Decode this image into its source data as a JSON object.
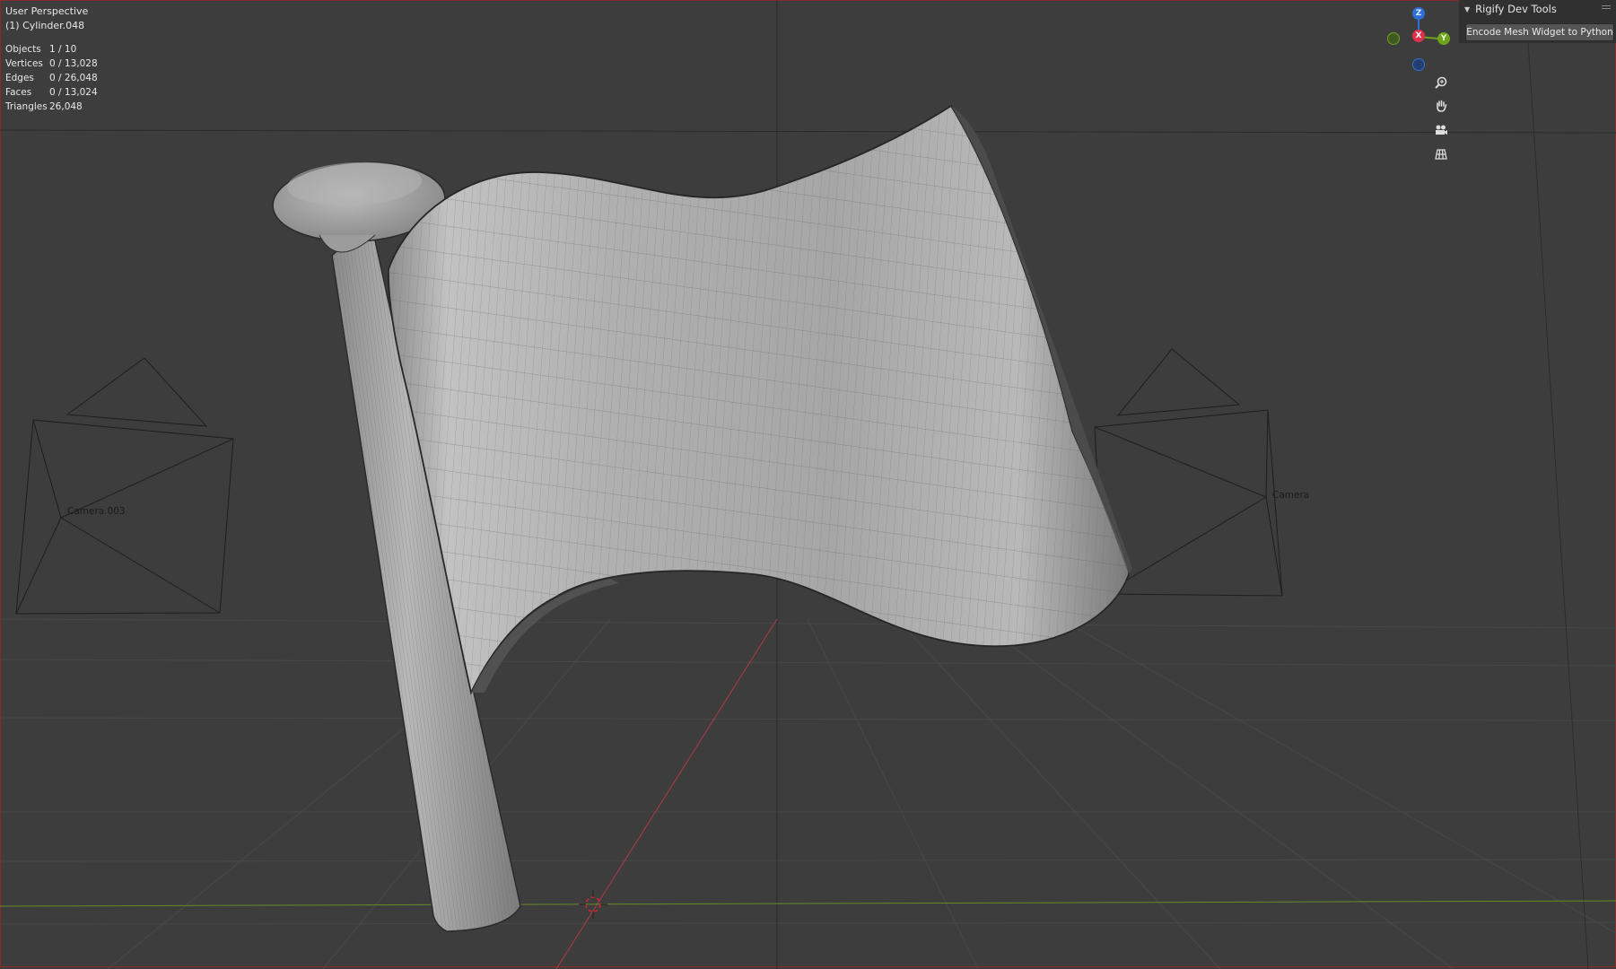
{
  "viewport": {
    "view_name": "User Perspective",
    "active_object": "(1) Cylinder.048"
  },
  "stats": [
    {
      "label": "Objects",
      "value": "1 / 10"
    },
    {
      "label": "Vertices",
      "value": "0 / 13,028"
    },
    {
      "label": "Edges",
      "value": "0 / 26,048"
    },
    {
      "label": "Faces",
      "value": "0 / 13,024"
    },
    {
      "label": "Triangles",
      "value": "26,048"
    }
  ],
  "scene_objects": {
    "left_camera": "Camera.003",
    "right_camera": "Camera"
  },
  "gizmo": {
    "axis_z": "Z",
    "axis_x": "X",
    "axis_y": "Y"
  },
  "nav_icons": [
    "zoom-icon",
    "pan-hand-icon",
    "camera-view-icon",
    "ortho-grid-icon"
  ],
  "sidebar": {
    "panel_title": "Rigify Dev Tools",
    "button_label": "Encode Mesh Widget to Python"
  },
  "colors": {
    "background": "#3d3d3d",
    "x_axis": "#e0314c",
    "y_axis": "#6ea31f",
    "z_axis": "#2f6fd8",
    "mesh": "#b4b4b4"
  }
}
